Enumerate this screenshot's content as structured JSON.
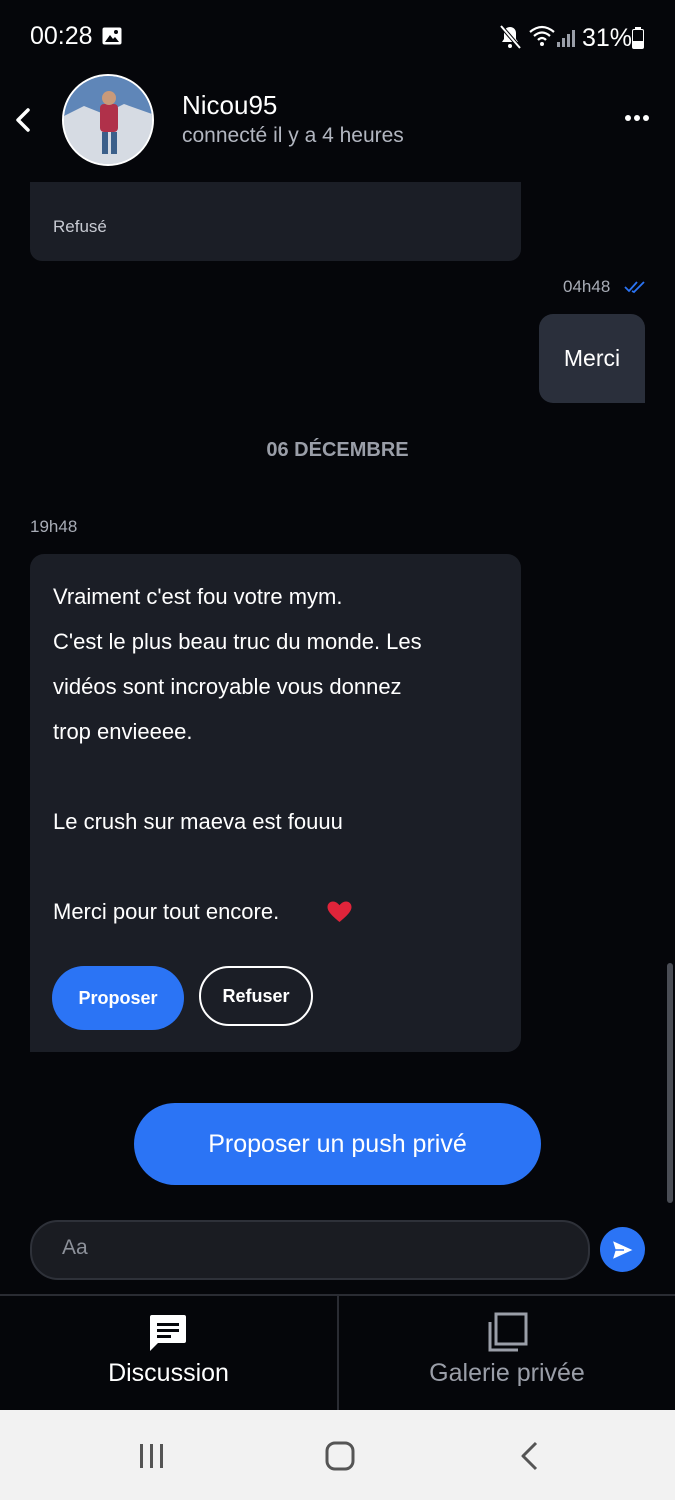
{
  "status_bar": {
    "time": "00:28",
    "battery": "31%",
    "icons": [
      "image-icon",
      "mute-icon",
      "wifi-icon",
      "signal-icon",
      "battery-icon"
    ]
  },
  "header": {
    "name": "Nicou95",
    "status": "connecté il y a 4 heures"
  },
  "messages": {
    "refused_label": "Refusé",
    "out_time": "04h48",
    "out_text": "Merci",
    "date_separator": "06 DÉCEMBRE",
    "in_time": "19h48",
    "in_lines": [
      "Vraiment c'est fou votre mym.",
      "C'est le plus beau truc du monde. Les",
      "vidéos sont incroyable vous donnez",
      "trop envieeee.",
      "Le crush sur maeva est fouuu",
      "Merci pour tout encore."
    ],
    "propose_label": "Proposer",
    "refuse_label": "Refuser"
  },
  "push_button": "Proposer un push privé",
  "composer": {
    "placeholder": "Aa"
  },
  "tabs": [
    {
      "label": "Discussion",
      "icon": "chat-icon",
      "active": true
    },
    {
      "label": "Galerie privée",
      "icon": "gallery-icon",
      "active": false
    }
  ],
  "colors": {
    "background": "#05060a",
    "bubble": "#1b1e26",
    "accent": "#2b74f5"
  }
}
